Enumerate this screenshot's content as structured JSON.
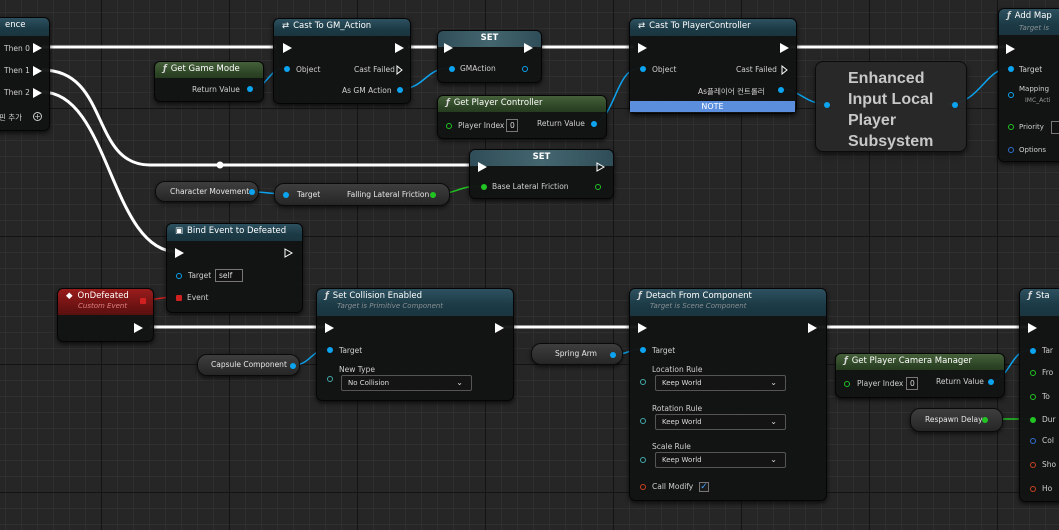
{
  "sequence": {
    "title_fragment": "ence",
    "pins": [
      "Then 0",
      "Then 1",
      "Then 2"
    ],
    "add_pin": "핀 추가"
  },
  "cast_gm": {
    "title": "Cast To GM_Action",
    "object": "Object",
    "cast_failed": "Cast Failed",
    "as_out": "As GM Action"
  },
  "set_gm": {
    "title": "SET",
    "pin": "GMAction"
  },
  "get_game_mode": {
    "title": "Get Game Mode",
    "out": "Return Value"
  },
  "cast_pc": {
    "title": "Cast To PlayerController",
    "object": "Object",
    "cast_failed": "Cast Failed",
    "as_out": "As플레이어 컨트롤러",
    "note": "NOTE"
  },
  "get_player_controller": {
    "title": "Get Player Controller",
    "player_index": "Player Index",
    "index_value": "0",
    "out": "Return Value"
  },
  "enhanced_input": {
    "title": "Enhanced Input Local Player Subsystem"
  },
  "add_mapping": {
    "title": "Add Map",
    "subtitle": "Target is",
    "pins": [
      "Target",
      "Mapping",
      "IMC_Acti",
      "Priority",
      "Options"
    ]
  },
  "set_friction": {
    "title": "SET",
    "pin": "Base Lateral Friction"
  },
  "character_movement": {
    "label": "Character Movement"
  },
  "falling_friction": {
    "target": "Target",
    "out": "Falling Lateral Friction"
  },
  "bind_event": {
    "title": "Bind Event to Defeated",
    "target": "Target",
    "target_value": "self",
    "event": "Event"
  },
  "on_defeated": {
    "title": "OnDefeated",
    "subtitle": "Custom Event"
  },
  "set_collision": {
    "title": "Set Collision Enabled",
    "subtitle": "Target is Primitive Component",
    "target": "Target",
    "new_type": "New Type",
    "new_type_value": "No Collision"
  },
  "capsule_component": {
    "label": "Capsule Component"
  },
  "detach": {
    "title": "Detach From Component",
    "subtitle": "Target is Scene Component",
    "target": "Target",
    "location_rule": "Location Rule",
    "location_value": "Keep World",
    "rotation_rule": "Rotation Rule",
    "rotation_value": "Keep World",
    "scale_rule": "Scale Rule",
    "scale_value": "Keep World",
    "call_modify": "Call Modify"
  },
  "spring_arm": {
    "label": "Spring Arm"
  },
  "get_camera_manager": {
    "title": "Get Player Camera Manager",
    "player_index": "Player Index",
    "index_value": "0",
    "out": "Return Value"
  },
  "respawn_delay": {
    "label": "Respawn Delay"
  },
  "start_node": {
    "title_fragment": "Sta",
    "pins": [
      "Tar",
      "Fro",
      "To",
      "Dur",
      "Col",
      "Sho",
      "Ho"
    ]
  },
  "colors": {
    "exec": "#ffffff",
    "object": "#0ca4f0",
    "float": "#21c423",
    "event": "#d02020",
    "note": "#5b8fde"
  }
}
